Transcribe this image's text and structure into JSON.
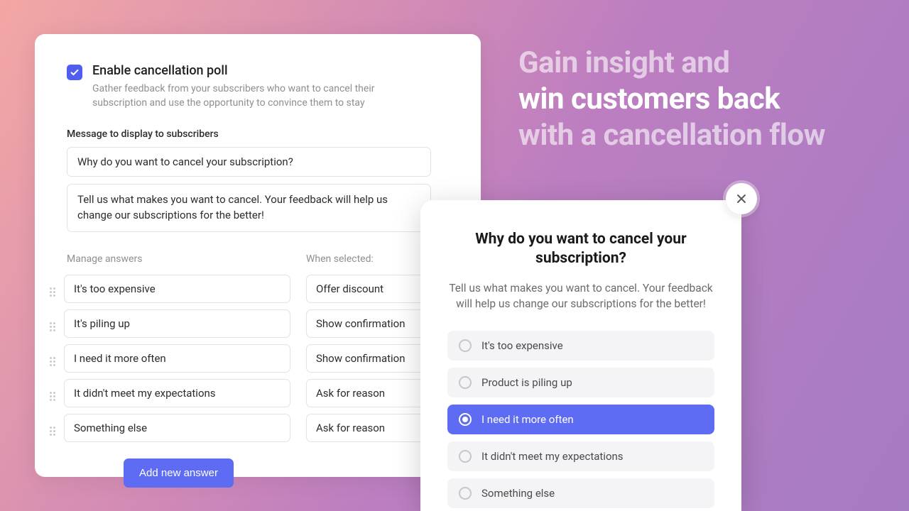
{
  "headline": {
    "line1": "Gain insight and",
    "line2": "win customers back",
    "line3": "with a cancellation flow"
  },
  "admin": {
    "checkbox_checked": true,
    "title": "Enable cancellation poll",
    "subtitle": "Gather feedback from your subscribers who want to cancel their subscription and use the opportunity to convince them to stay",
    "message_label": "Message to display to subscribers",
    "message_title_value": "Why do you want to cancel your subscription?",
    "message_body_value": "Tell us what makes you want to cancel. Your feedback will help us change our  subscriptions for the better!",
    "manage_label": "Manage answers",
    "when_selected_label": "When selected:",
    "answers": [
      {
        "label": "It's too expensive",
        "action": "Offer discount"
      },
      {
        "label": "It's piling up",
        "action": "Show confirmation"
      },
      {
        "label": "I need it more often",
        "action": "Show confirmation"
      },
      {
        "label": "It didn't meet my expectations",
        "action": "Ask for reason"
      },
      {
        "label": "Something else",
        "action": "Ask for reason"
      }
    ],
    "add_button": "Add new answer"
  },
  "popup": {
    "title": "Why do you want to cancel your subscription?",
    "subtitle": "Tell us what makes you want to cancel. Your feedback will help us change our subscriptions for the better!",
    "options": [
      {
        "label": "It's too expensive",
        "selected": false
      },
      {
        "label": "Product is piling up",
        "selected": false
      },
      {
        "label": "I need it more often",
        "selected": true
      },
      {
        "label": "It didn't meet my expectations",
        "selected": false
      },
      {
        "label": "Something else",
        "selected": false
      }
    ]
  },
  "colors": {
    "primary": "#5d6cf2",
    "checkbox": "#4f5ef1"
  }
}
